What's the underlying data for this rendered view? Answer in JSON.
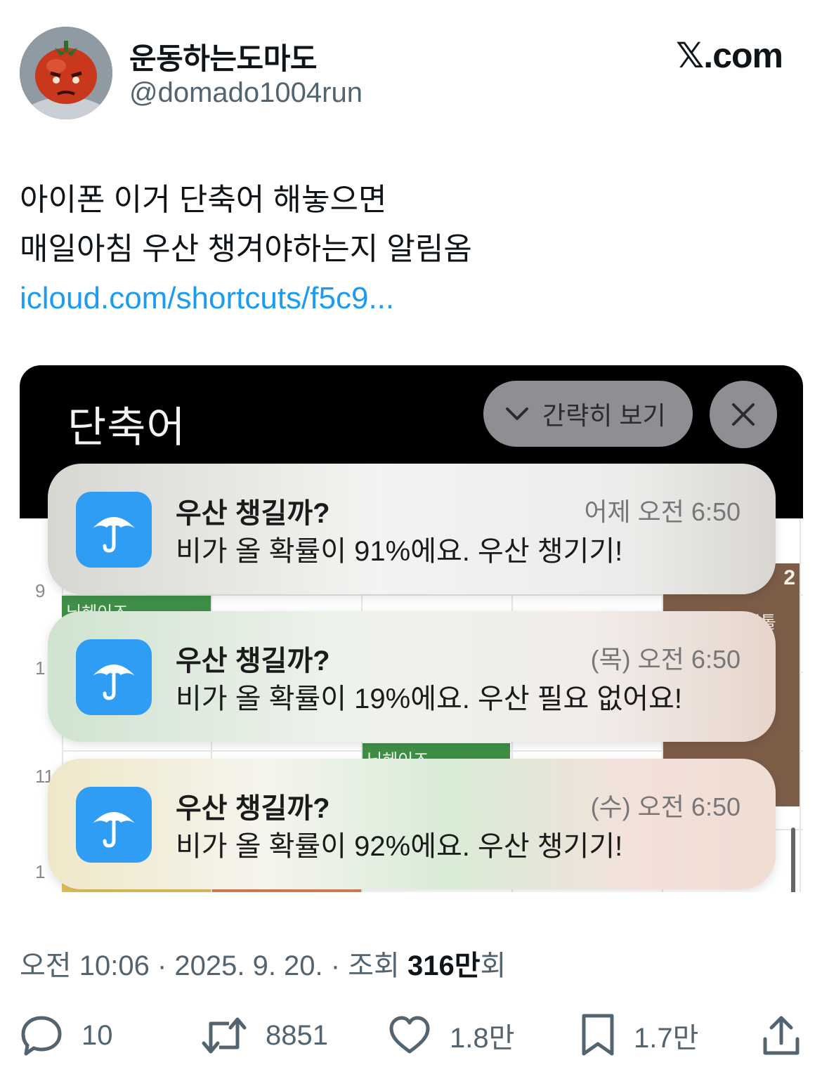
{
  "author": {
    "display_name": "운동하는도마도",
    "handle": "@domado1004run"
  },
  "brand": "𝕏.com",
  "tweet": {
    "line1": "아이폰 이거 단축어 해놓으면",
    "line2": "매일아침 우산 챙겨야하는지 알림옴",
    "link": "icloud.com/shortcuts/f5c9..."
  },
  "media": {
    "title": "단축어",
    "collapse_label": "간략히 보기",
    "calendar": {
      "hours": [
        "9",
        "1",
        "11",
        "1"
      ],
      "events": [
        "닉헤이즈",
        "닉헤이즈",
        "2",
        "드리바데미시톨"
      ]
    },
    "notifications": [
      {
        "icon": "umbrella-icon",
        "title": "우산 챙길까?",
        "time": "어제 오전 6:50",
        "body": "비가 올 확률이 91%에요. 우산 챙기기!"
      },
      {
        "icon": "umbrella-icon",
        "title": "우산 챙길까?",
        "time": "(목) 오전 6:50",
        "body": "비가 올 확률이 19%에요. 우산 필요 없어요!"
      },
      {
        "icon": "umbrella-icon",
        "title": "우산 챙길까?",
        "time": "(수) 오전 6:50",
        "body": "비가 올 확률이 92%에요. 우산 챙기기!"
      }
    ]
  },
  "meta": {
    "time": "오전 10:06",
    "date": "2025. 9. 20.",
    "views_label": "조회",
    "views_value": "316만",
    "views_suffix": "회"
  },
  "actions": {
    "replies": "10",
    "reposts": "8851",
    "likes": "1.8만",
    "bookmarks": "1.7만"
  },
  "colors": {
    "link": "#1d9bf0",
    "app_icon": "#2f9df4",
    "muted_text": "#536471"
  }
}
